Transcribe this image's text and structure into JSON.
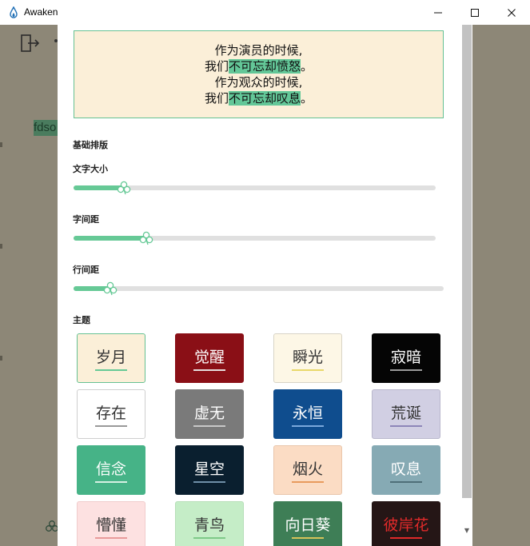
{
  "window": {
    "title": "Awaken",
    "min_icon": "minimize-icon",
    "max_icon": "maximize-icon",
    "close_icon": "close-icon"
  },
  "background_app": {
    "selected_text": "fdso",
    "exit_icon": "exit-door-icon",
    "clover_icon": "clover-icon"
  },
  "preview": {
    "lines": [
      {
        "plain": "作为演员的时候,",
        "highlight": "",
        "tail": ""
      },
      {
        "plain": "我们",
        "highlight": "不可忘却愤怒",
        "tail": "。"
      },
      {
        "plain": "作为观众的时候,",
        "highlight": "",
        "tail": ""
      },
      {
        "plain": "我们",
        "highlight": "不可忘却叹息",
        "tail": "。"
      }
    ],
    "highlight_color": "#63c798"
  },
  "typography": {
    "section_title": "基础排版",
    "sliders": [
      {
        "label": "文字大小",
        "value": 0.14
      },
      {
        "label": "字间距",
        "value": 0.2
      },
      {
        "label": "行间距",
        "value": 0.1
      }
    ],
    "thumb_icon": "clover-thumb-icon",
    "accent": "#66c996"
  },
  "themes": {
    "section_title": "主题",
    "items": [
      {
        "label": "岁月",
        "bg": "#fbefd8",
        "fg": "#333333",
        "bar": "#66c996",
        "border": "#66c193"
      },
      {
        "label": "觉醒",
        "bg": "#8a0f16",
        "fg": "#ffffff",
        "bar": "#e6dede",
        "border": "#8a0f16"
      },
      {
        "label": "瞬光",
        "bg": "#fdf7e6",
        "fg": "#333333",
        "bar": "#e8d86a",
        "border": "#d8d4c6"
      },
      {
        "label": "寂暗",
        "bg": "#050505",
        "fg": "#ffffff",
        "bar": "#9a9a9a",
        "border": "#050505"
      },
      {
        "label": "存在",
        "bg": "#ffffff",
        "fg": "#333333",
        "bar": "#9a9a9a",
        "border": "#cfcfcf"
      },
      {
        "label": "虚无",
        "bg": "#7a7a7a",
        "fg": "#ffffff",
        "bar": "#c8c8c8",
        "border": "#7a7a7a"
      },
      {
        "label": "永恒",
        "bg": "#0f4d8e",
        "fg": "#ffffff",
        "bar": "#7aa8dc",
        "border": "#0f4d8e"
      },
      {
        "label": "荒诞",
        "bg": "#d1cfe3",
        "fg": "#333333",
        "bar": "#8d86b8",
        "border": "#b9b7cc"
      },
      {
        "label": "信念",
        "bg": "#46b387",
        "fg": "#ffffff",
        "bar": "#d6f0e3",
        "border": "#46b387"
      },
      {
        "label": "星空",
        "bg": "#0a1f2f",
        "fg": "#ffffff",
        "bar": "#6f8fa8",
        "border": "#0a1f2f"
      },
      {
        "label": "烟火",
        "bg": "#fbdcc4",
        "fg": "#333333",
        "bar": "#e89b5e",
        "border": "#e9c6ab"
      },
      {
        "label": "叹息",
        "bg": "#86aab4",
        "fg": "#ffffff",
        "bar": "#4f6f78",
        "border": "#86aab4"
      },
      {
        "label": "懵懂",
        "bg": "#fde1e1",
        "fg": "#333333",
        "bar": "#e89a9a",
        "border": "#f0cccc"
      },
      {
        "label": "青鸟",
        "bg": "#c5edc7",
        "fg": "#333333",
        "bar": "#7ec988",
        "border": "#b6dfb8"
      },
      {
        "label": "向日葵",
        "bg": "#3e7e56",
        "fg": "#ffffff",
        "bar": "#d7c35a",
        "border": "#3e7e56"
      },
      {
        "label": "彼岸花",
        "bg": "#251616",
        "fg": "#e02a2a",
        "bar": "#e02a2a",
        "border": "#251616"
      }
    ]
  },
  "scrollbar": {
    "down_icon": "scroll-down-arrow-icon"
  }
}
